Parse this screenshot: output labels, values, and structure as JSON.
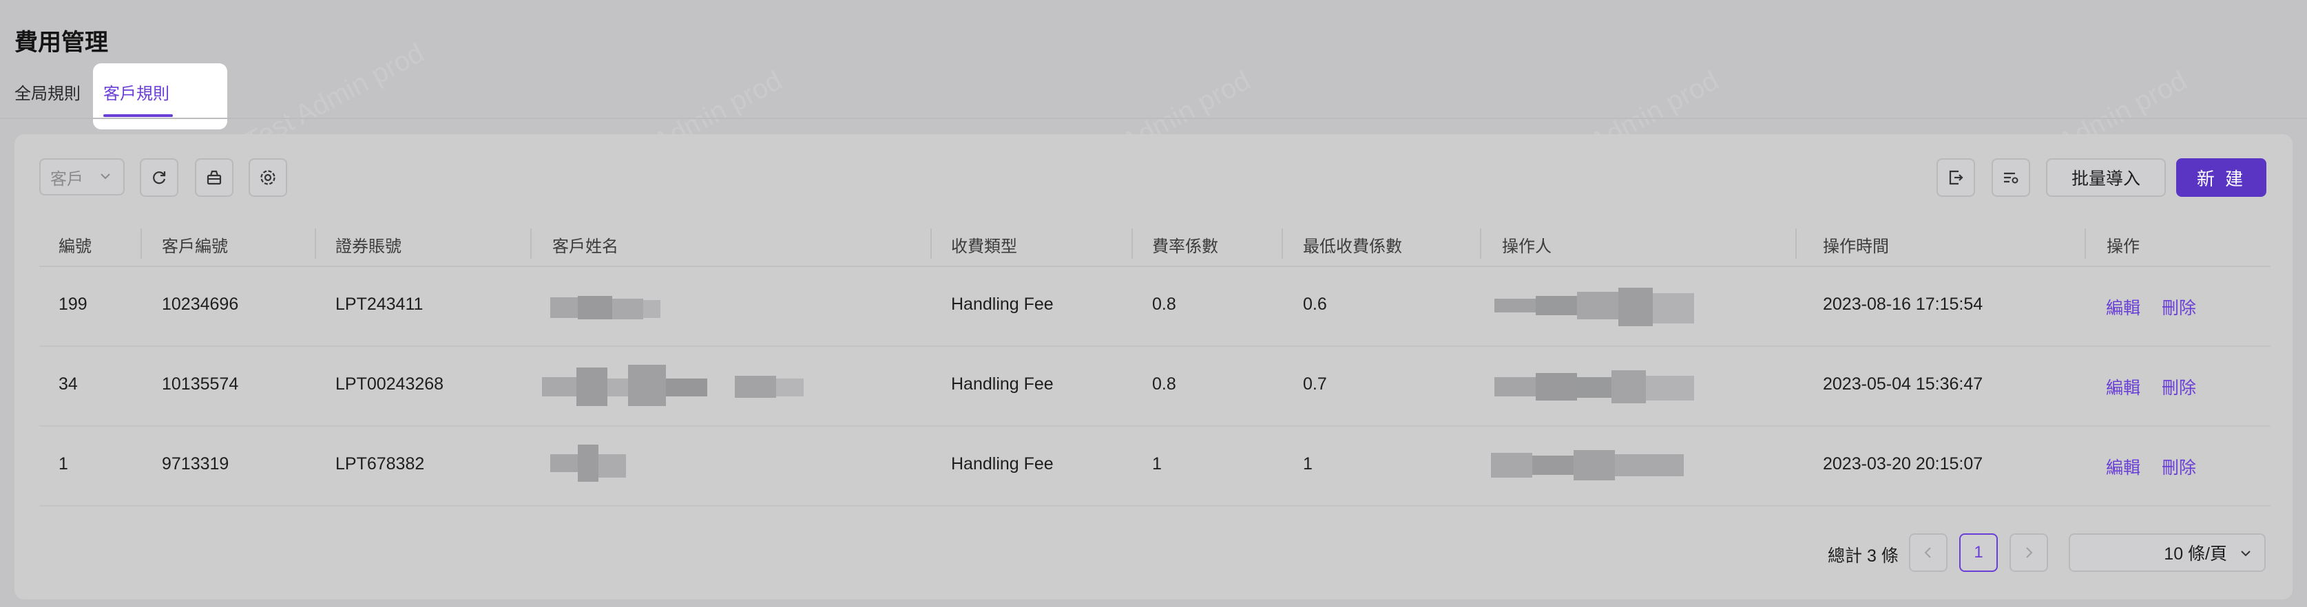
{
  "page": {
    "title": "費用管理"
  },
  "tabs": [
    {
      "label": "全局規則",
      "active": false
    },
    {
      "label": "客戶規則",
      "active": true
    }
  ],
  "toolbar": {
    "filter_select": {
      "value": "客戶",
      "icon": "chevron-down-icon"
    },
    "icons": [
      "refresh-icon",
      "basket-icon",
      "settings-icon",
      "export-icon",
      "column-settings-icon"
    ],
    "batch_import_label": "批量導入",
    "new_label": "新 建"
  },
  "table": {
    "columns": [
      "編號",
      "客戶編號",
      "證券賬號",
      "客戶姓名",
      "收費類型",
      "費率係數",
      "最低收費係數",
      "操作人",
      "操作時間",
      "操作"
    ],
    "rows": [
      {
        "id": "199",
        "customer_no": "10234696",
        "account": "LPT243411",
        "fee_type": "Handling Fee",
        "rate": "0.8",
        "min_rate": "0.6",
        "time": "2023-08-16 17:15:54",
        "edit": "編輯",
        "delete": "刪除"
      },
      {
        "id": "34",
        "customer_no": "10135574",
        "account": "LPT00243268",
        "fee_type": "Handling Fee",
        "rate": "0.8",
        "min_rate": "0.7",
        "time": "2023-05-04 15:36:47",
        "edit": "編輯",
        "delete": "刪除"
      },
      {
        "id": "1",
        "customer_no": "9713319",
        "account": "LPT678382",
        "fee_type": "Handling Fee",
        "rate": "1",
        "min_rate": "1",
        "time": "2023-03-20 20:15:07",
        "edit": "編輯",
        "delete": "刪除"
      }
    ]
  },
  "pagination": {
    "total_label": "總計 3 條",
    "prev_icon": "chevron-left-icon",
    "current_page": "1",
    "next_icon": "chevron-right-icon",
    "page_size": "10 條/頁"
  },
  "watermark": "LongPort Test Admin prod",
  "colors": {
    "accent": "#6a3fd6",
    "primary_button": "#5a35c4",
    "overlay_bg": "#c3c3c6"
  }
}
